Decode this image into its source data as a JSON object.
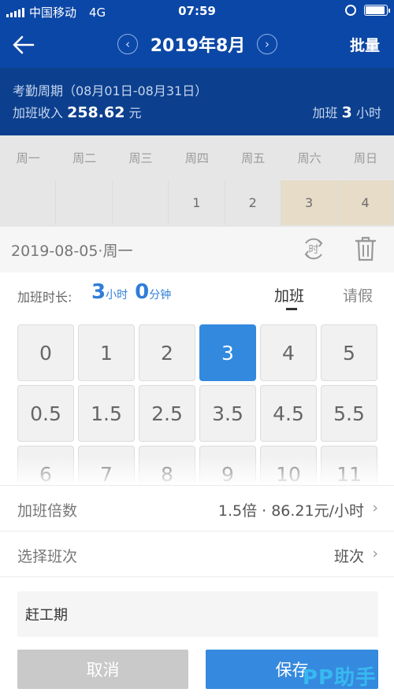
{
  "status_bar": {
    "carrier": "中国移动",
    "network": "4G",
    "time": "07:59"
  },
  "nav": {
    "title": "2019年8月",
    "prev_icon": "‹",
    "next_icon": "›",
    "batch_label": "批量"
  },
  "summary": {
    "cycle_text": "考勤周期（08月01日-08月31日）",
    "income_label": "加班收入",
    "income_value": "258.62",
    "income_unit": "元",
    "ot_label": "加班",
    "ot_value": "3",
    "ot_unit": "小时"
  },
  "calendar": {
    "weekdays": [
      "周一",
      "周二",
      "周三",
      "周四",
      "周五",
      "周六",
      "周日"
    ],
    "first_row": [
      "",
      "",
      "",
      "1",
      "2",
      "3",
      "4"
    ]
  },
  "sheet": {
    "date_text": "2019-08-05·周一",
    "shift_icon_text": "时",
    "duration_label": "加班时长:",
    "duration_hours": "3",
    "hours_unit": "小时",
    "duration_minutes": "0",
    "minutes_unit": "分钟",
    "tab_overtime": "加班",
    "tab_leave": "请假"
  },
  "keypad": {
    "keys": [
      "0",
      "1",
      "2",
      "3",
      "4",
      "5",
      "0.5",
      "1.5",
      "2.5",
      "3.5",
      "4.5",
      "5.5",
      "6",
      "7",
      "8",
      "9",
      "10",
      "11"
    ],
    "selected": "3"
  },
  "options": {
    "multiplier_label": "加班倍数",
    "multiplier_value": "1.5倍 · 86.21元/小时",
    "shift_label": "选择班次",
    "shift_value": "班次",
    "chevron": "›"
  },
  "note": {
    "value": "赶工期"
  },
  "actions": {
    "cancel_label": "取消",
    "save_label": "保存"
  },
  "watermark": "PP助手",
  "colors": {
    "header_blue": "#0b47a6",
    "accent_blue": "#3289de",
    "weekend_tint": "#e7dcc8"
  }
}
